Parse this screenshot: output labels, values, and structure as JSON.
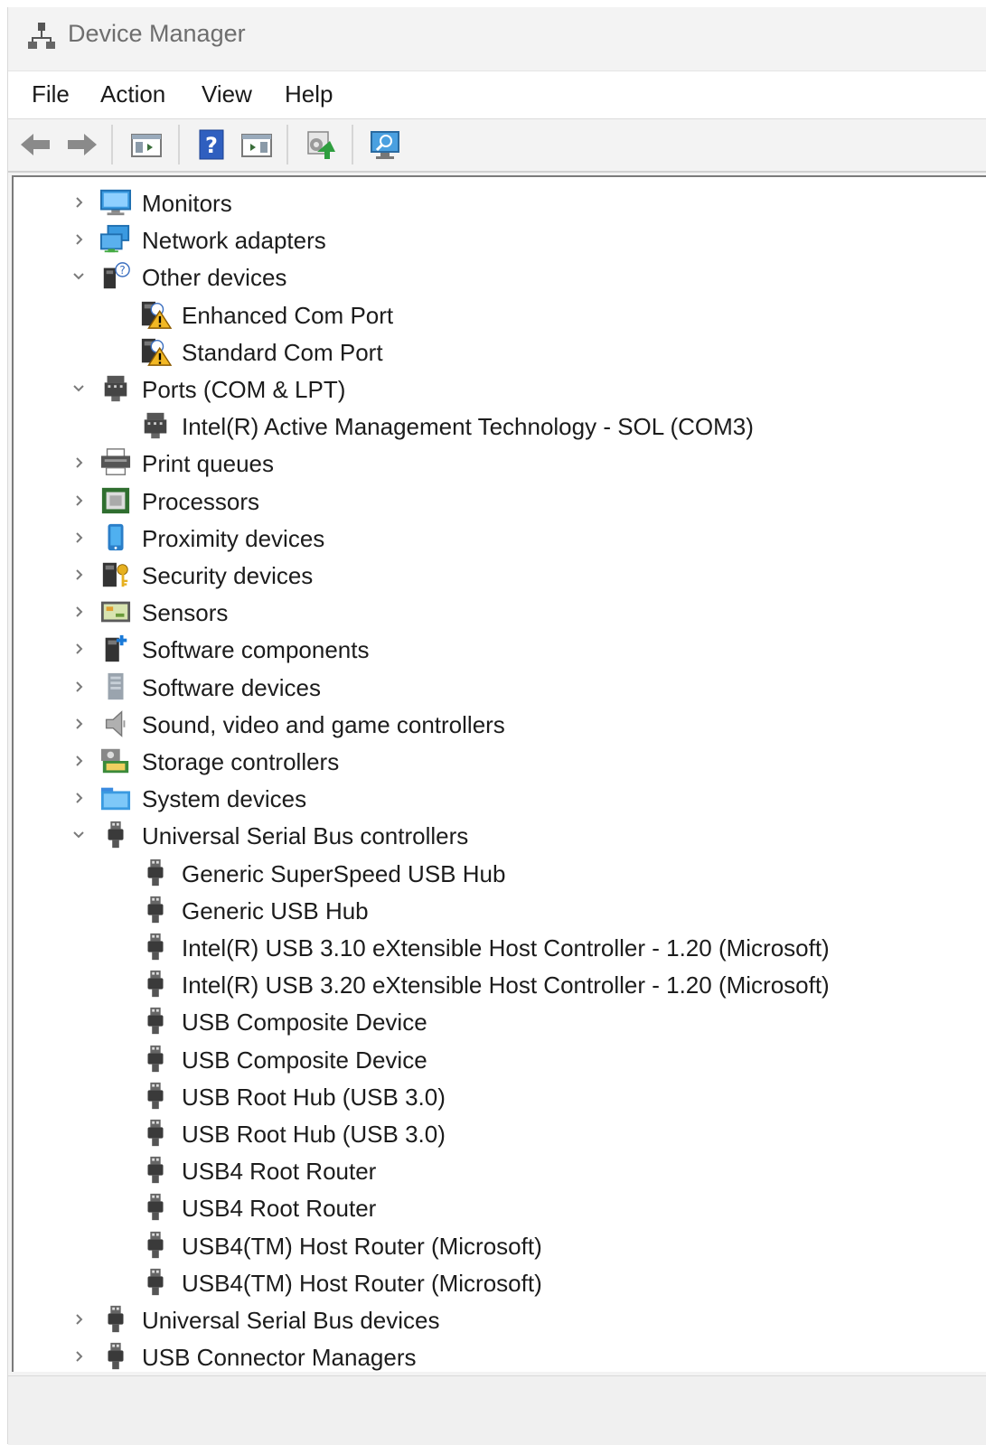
{
  "window": {
    "title": "Device Manager"
  },
  "menu": [
    "File",
    "Action",
    "View",
    "Help"
  ],
  "toolbar": {
    "buttons": [
      "back-arrow-icon",
      "forward-arrow-icon",
      "show-hide-console-tree-icon",
      "help-icon",
      "properties-pane-icon",
      "update-driver-icon",
      "scan-hardware-icon"
    ]
  },
  "tree": [
    {
      "label": "Monitors",
      "level": 0,
      "state": "collapsed",
      "icon": "monitor-icon"
    },
    {
      "label": "Network adapters",
      "level": 0,
      "state": "collapsed",
      "icon": "network-adapter-icon"
    },
    {
      "label": "Other devices",
      "level": 0,
      "state": "expanded",
      "icon": "unknown-device-icon"
    },
    {
      "label": "Enhanced Com Port",
      "level": 1,
      "state": "leaf",
      "icon": "warning-device-icon"
    },
    {
      "label": "Standard Com Port",
      "level": 1,
      "state": "leaf",
      "icon": "warning-device-icon"
    },
    {
      "label": "Ports (COM & LPT)",
      "level": 0,
      "state": "expanded",
      "icon": "port-icon"
    },
    {
      "label": "Intel(R) Active Management Technology - SOL (COM3)",
      "level": 1,
      "state": "leaf",
      "icon": "port-icon"
    },
    {
      "label": "Print queues",
      "level": 0,
      "state": "collapsed",
      "icon": "printer-icon"
    },
    {
      "label": "Processors",
      "level": 0,
      "state": "collapsed",
      "icon": "processor-icon"
    },
    {
      "label": "Proximity devices",
      "level": 0,
      "state": "collapsed",
      "icon": "proximity-icon"
    },
    {
      "label": "Security devices",
      "level": 0,
      "state": "collapsed",
      "icon": "security-key-icon"
    },
    {
      "label": "Sensors",
      "level": 0,
      "state": "collapsed",
      "icon": "sensor-icon"
    },
    {
      "label": "Software components",
      "level": 0,
      "state": "collapsed",
      "icon": "software-component-icon"
    },
    {
      "label": "Software devices",
      "level": 0,
      "state": "collapsed",
      "icon": "software-device-icon"
    },
    {
      "label": "Sound, video and game controllers",
      "level": 0,
      "state": "collapsed",
      "icon": "speaker-icon"
    },
    {
      "label": "Storage controllers",
      "level": 0,
      "state": "collapsed",
      "icon": "storage-controller-icon"
    },
    {
      "label": "System devices",
      "level": 0,
      "state": "collapsed",
      "icon": "system-folder-icon"
    },
    {
      "label": "Universal Serial Bus controllers",
      "level": 0,
      "state": "expanded",
      "icon": "usb-plug-icon"
    },
    {
      "label": "Generic SuperSpeed USB Hub",
      "level": 1,
      "state": "leaf",
      "icon": "usb-plug-icon"
    },
    {
      "label": "Generic USB Hub",
      "level": 1,
      "state": "leaf",
      "icon": "usb-plug-icon"
    },
    {
      "label": "Intel(R) USB 3.10 eXtensible Host Controller - 1.20 (Microsoft)",
      "level": 1,
      "state": "leaf",
      "icon": "usb-plug-icon"
    },
    {
      "label": "Intel(R) USB 3.20 eXtensible Host Controller - 1.20 (Microsoft)",
      "level": 1,
      "state": "leaf",
      "icon": "usb-plug-icon"
    },
    {
      "label": "USB Composite Device",
      "level": 1,
      "state": "leaf",
      "icon": "usb-plug-icon"
    },
    {
      "label": "USB Composite Device",
      "level": 1,
      "state": "leaf",
      "icon": "usb-plug-icon"
    },
    {
      "label": "USB Root Hub (USB 3.0)",
      "level": 1,
      "state": "leaf",
      "icon": "usb-plug-icon"
    },
    {
      "label": "USB Root Hub (USB 3.0)",
      "level": 1,
      "state": "leaf",
      "icon": "usb-plug-icon"
    },
    {
      "label": "USB4 Root Router",
      "level": 1,
      "state": "leaf",
      "icon": "usb-plug-icon"
    },
    {
      "label": "USB4 Root Router",
      "level": 1,
      "state": "leaf",
      "icon": "usb-plug-icon"
    },
    {
      "label": "USB4(TM) Host Router (Microsoft)",
      "level": 1,
      "state": "leaf",
      "icon": "usb-plug-icon"
    },
    {
      "label": "USB4(TM) Host Router (Microsoft)",
      "level": 1,
      "state": "leaf",
      "icon": "usb-plug-icon"
    },
    {
      "label": "Universal Serial Bus devices",
      "level": 0,
      "state": "collapsed",
      "icon": "usb-plug-icon"
    },
    {
      "label": "USB Connector Managers",
      "level": 0,
      "state": "collapsed",
      "icon": "usb-plug-icon"
    }
  ]
}
